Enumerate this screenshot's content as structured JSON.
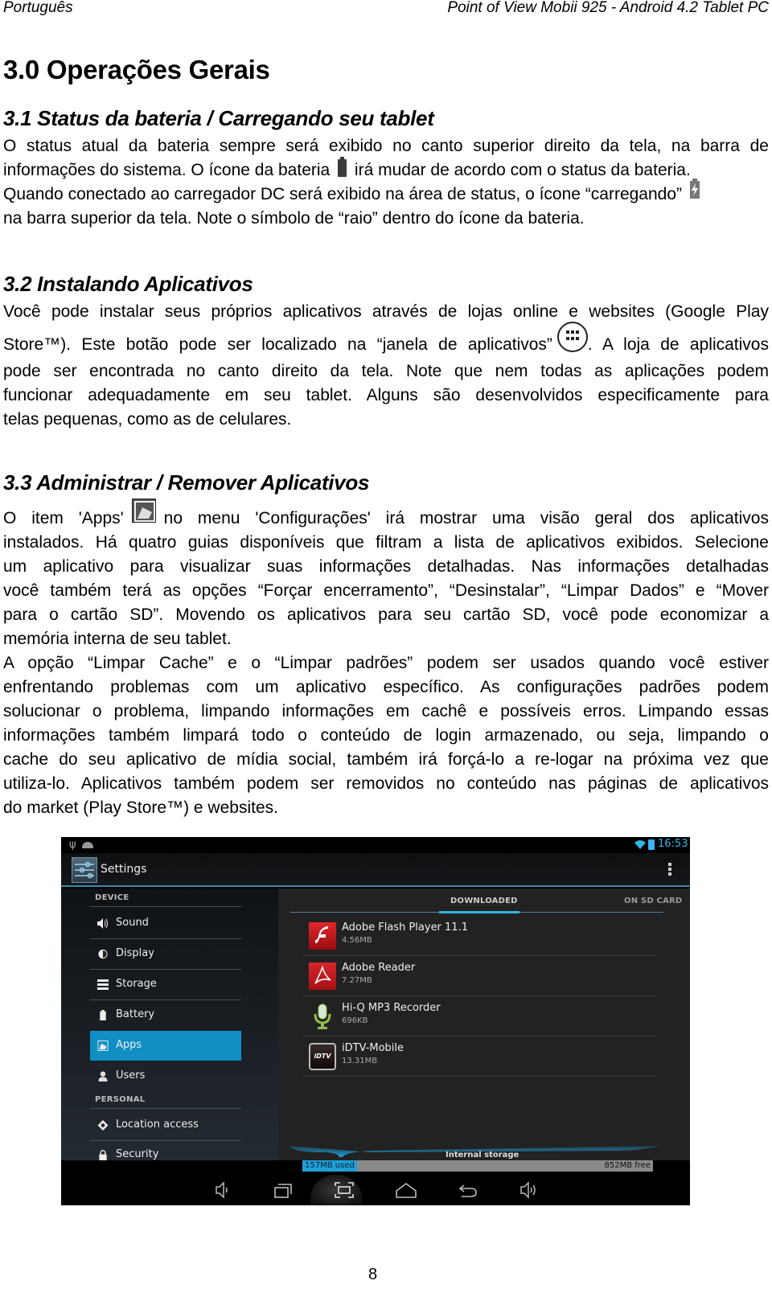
{
  "header": {
    "language": "Português",
    "document_title": "Point of View Mobii 925 - Android 4.2 Tablet PC"
  },
  "chapter_title": "3.0 Operações Gerais",
  "sections": [
    {
      "title": "3.1 Status da bateria / Carregando seu tablet",
      "lines": [
        "O status atual da bateria sempre será exibido no canto superior direito da tela, na barra de",
        "informações do sistema. O ícone da bateria",
        "irá mudar de acordo com o status da bateria.",
        "Quando conectado ao carregador DC será exibido na área de status, o ícone “carregando”",
        "na barra superior da tela. Note o símbolo de “raio” dentro do ícone da bateria."
      ],
      "icons": [
        "battery-icon",
        "battery-charging-icon"
      ]
    },
    {
      "title": "3.2 Instalando Aplicativos",
      "lines": [
        "Você pode instalar seus próprios aplicativos através de lojas online e websites (Google Play",
        "Store™). Este botão pode ser localizado na “janela de aplicativos”",
        ". A loja de aplicativos",
        "pode ser encontrada no canto direito da tela. Note que nem todas as aplicações podem",
        "funcionar adequadamente em seu tablet. Alguns são desenvolvidos especificamente para",
        "telas pequenas, como as de celulares."
      ],
      "icons": [
        "app-drawer-icon"
      ]
    },
    {
      "title": "3.3 Administrar / Remover Aplicativos",
      "lines": [
        "O item 'Apps'",
        "no menu 'Configurações' irá mostrar uma visão geral dos aplicativos",
        "instalados. Há quatro guias disponíveis que filtram a lista de aplicativos exibidos. Selecione",
        "um aplicativo para visualizar suas informações detalhadas. Nas informações detalhadas",
        "você também terá as opções “Forçar encerramento”, “Desinstalar”, “Limpar Dados” e “Mover",
        "para o cartão SD”. Movendo os aplicativos para seu cartão SD, você pode economizar a",
        "memória interna de seu tablet.",
        "A opção “Limpar Cache” e o “Limpar padrões” podem ser usados quando você estiver",
        "enfrentando problemas com um aplicativo específico. As configurações padrões podem",
        "solucionar o problema, limpando informações em cachê e possíveis erros. Limpando essas",
        "informações também limpará todo o conteúdo de login armazenado, ou seja, limpando o",
        "cache do seu aplicativo de mídia social, também irá forçá-lo a re-logar na próxima vez que",
        "utiliza-lo. Aplicativos também podem ser removidos no conteúdo nas páginas de aplicativos",
        "do market (Play Store™) e websites."
      ],
      "icons": [
        "apps-settings-icon"
      ]
    }
  ],
  "screenshot": {
    "status_bar": {
      "time": "16:53",
      "icons": [
        "usb-icon",
        "android-debug-icon",
        "wifi-icon",
        "battery-charging-icon"
      ]
    },
    "action_bar": {
      "title": "Settings",
      "icons": [
        "settings-icon",
        "overflow-menu-icon"
      ]
    },
    "sidebar": {
      "categories": [
        "DEVICE",
        "PERSONAL"
      ],
      "items": [
        {
          "label": "Sound",
          "icon": "sound-icon",
          "category": "DEVICE"
        },
        {
          "label": "Display",
          "icon": "display-icon",
          "category": "DEVICE"
        },
        {
          "label": "Storage",
          "icon": "storage-icon",
          "category": "DEVICE"
        },
        {
          "label": "Battery",
          "icon": "battery-icon",
          "category": "DEVICE"
        },
        {
          "label": "Apps",
          "icon": "apps-icon",
          "category": "DEVICE",
          "selected": true
        },
        {
          "label": "Users",
          "icon": "users-icon",
          "category": "DEVICE"
        },
        {
          "label": "Location access",
          "icon": "location-icon",
          "category": "PERSONAL"
        },
        {
          "label": "Security",
          "icon": "lock-icon",
          "category": "PERSONAL"
        }
      ]
    },
    "tabs": [
      {
        "label": "DOWNLOADED",
        "selected": true
      },
      {
        "label": "ON SD CARD",
        "selected": false
      }
    ],
    "apps": [
      {
        "name": "Adobe Flash Player 11.1",
        "size": "4.56MB",
        "icon": "flash-player-icon"
      },
      {
        "name": "Adobe Reader",
        "size": "7.27MB",
        "icon": "adobe-reader-icon"
      },
      {
        "name": "Hi-Q MP3 Recorder",
        "size": "696KB",
        "icon": "microphone-icon"
      },
      {
        "name": "iDTV-Mobile",
        "size": "13.31MB",
        "icon": "idtv-icon"
      }
    ],
    "storage": {
      "label": "Internal storage",
      "used": "157MB used",
      "free": "852MB free",
      "used_fraction": 0.156
    },
    "nav_bar": [
      "volume-down-icon",
      "recent-apps-icon",
      "screenshot-icon",
      "home-icon",
      "back-icon",
      "volume-up-icon"
    ],
    "colors": {
      "accent": "#33b5e5",
      "selected": "#0f8fc4",
      "panel": "#222222"
    }
  },
  "page_number": "8"
}
